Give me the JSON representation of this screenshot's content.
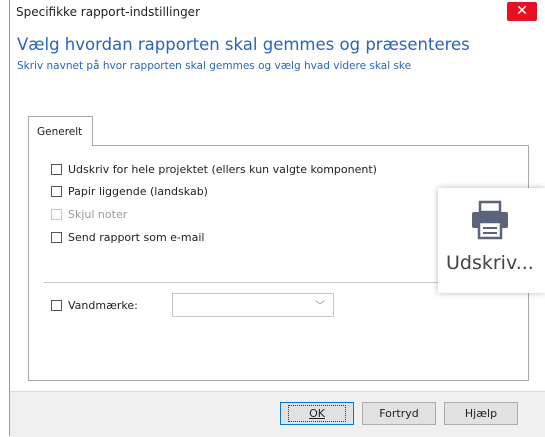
{
  "window": {
    "title": "Specifikke rapport-indstillinger",
    "close_glyph": "✕"
  },
  "header": {
    "heading": "Vælg hvordan rapporten skal gemmes og præsenteres",
    "subheading": "Skriv navnet på hvor rapporten skal gemmes og vælg hvad videre skal ske"
  },
  "tabs": [
    {
      "label": "Generelt",
      "active": true
    }
  ],
  "options": [
    {
      "label": "Udskriv for hele projektet (ellers kun valgte komponent)",
      "checked": false,
      "enabled": true
    },
    {
      "label": "Papir liggende (landskab)",
      "checked": false,
      "enabled": true
    },
    {
      "label": "Skjul noter",
      "checked": false,
      "enabled": false
    },
    {
      "label": "Send rapport som e-mail",
      "checked": false,
      "enabled": true
    }
  ],
  "watermark": {
    "label": "Vandmærke:",
    "checked": false,
    "value": ""
  },
  "buttons": {
    "ok": "OK",
    "cancel": "Fortryd",
    "help": "Hjælp"
  },
  "print_button": {
    "label": "Udskriv...",
    "icon": "printer-icon"
  },
  "colors": {
    "accent": "#2a64b8",
    "close": "#e81123",
    "printer_icon": "#5b6478"
  }
}
